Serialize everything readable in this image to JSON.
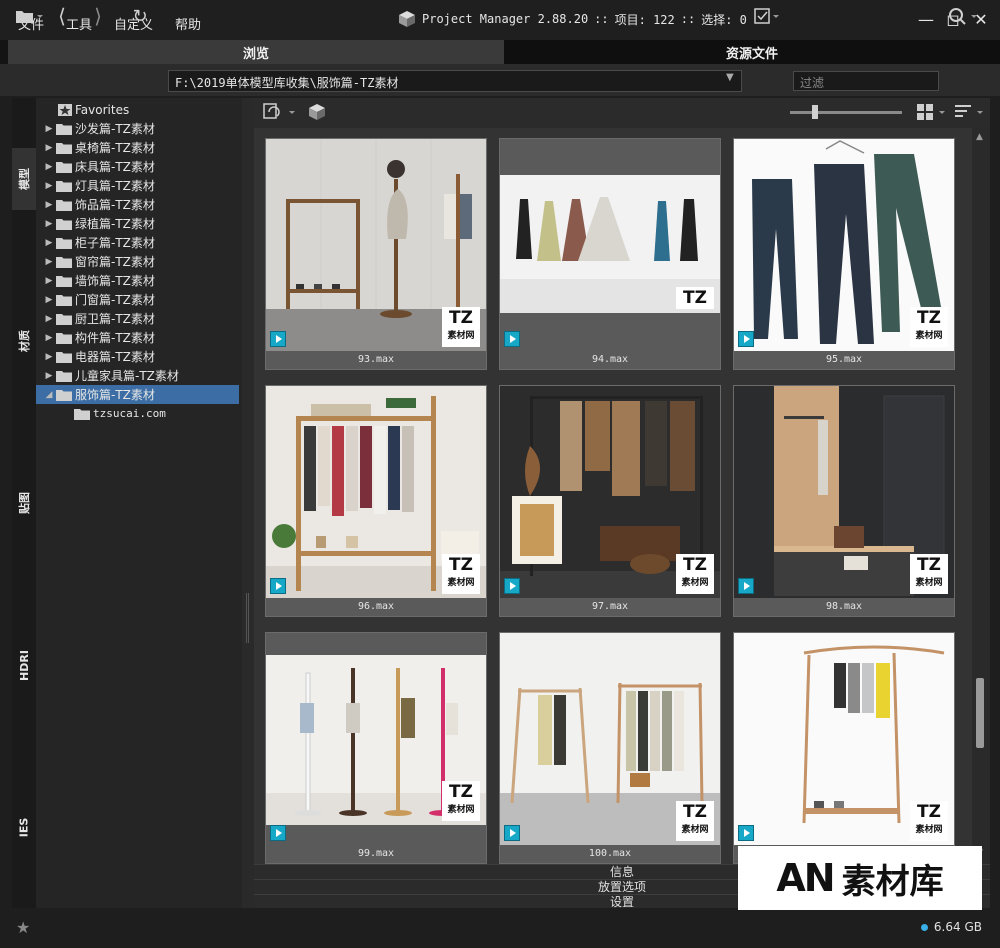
{
  "menu": [
    "文件",
    "工具",
    "自定义",
    "帮助"
  ],
  "app": {
    "title": "Project Manager 2.88.20",
    "items_label": "项目: 122",
    "selection_label": "选择: 0",
    "separator": "::"
  },
  "tabs": [
    {
      "label": "浏览",
      "active": true
    },
    {
      "label": "资源文件",
      "active": false
    }
  ],
  "toolbar": {
    "path": "F:\\2019单体模型库收集\\服饰篇-TZ素材",
    "filter_placeholder": "过滤"
  },
  "side_tabs": [
    "模型",
    "材质",
    "贴图",
    "HDRI",
    "IES"
  ],
  "tree": {
    "favorites_label": "Favorites",
    "items": [
      "沙发篇-TZ素材",
      "桌椅篇-TZ素材",
      "床具篇-TZ素材",
      "灯具篇-TZ素材",
      "饰品篇-TZ素材",
      "绿植篇-TZ素材",
      "柜子篇-TZ素材",
      "窗帘篇-TZ素材",
      "墙饰篇-TZ素材",
      "门窗篇-TZ素材",
      "厨卫篇-TZ素材",
      "构件篇-TZ素材",
      "电器篇-TZ素材",
      "儿童家具篇-TZ素材",
      "服饰篇-TZ素材"
    ],
    "selected_index": 14,
    "child_label": "tzsucai.com"
  },
  "cards": [
    {
      "label": "93.max",
      "tz": "TZ",
      "tz_sub": "素材网"
    },
    {
      "label": "94.max",
      "tz": "TZ",
      "tz_sub": ""
    },
    {
      "label": "95.max",
      "tz": "TZ",
      "tz_sub": "素材网"
    },
    {
      "label": "96.max",
      "tz": "TZ",
      "tz_sub": "素材网"
    },
    {
      "label": "97.max",
      "tz": "TZ",
      "tz_sub": "素材网"
    },
    {
      "label": "98.max",
      "tz": "TZ",
      "tz_sub": "素材网"
    },
    {
      "label": "99.max",
      "tz": "TZ",
      "tz_sub": "素材网"
    },
    {
      "label": "100.max",
      "tz": "TZ",
      "tz_sub": "素材网"
    },
    {
      "label": "",
      "tz": "TZ",
      "tz_sub": "素材网"
    }
  ],
  "bottom_panels": [
    "信息",
    "放置选项",
    "设置"
  ],
  "status": {
    "disk_free": "6.64 GB",
    "disk_color": "#3ab0e8"
  },
  "watermark": {
    "an": "AN",
    "cn": "素材库"
  },
  "colors": {
    "selection": "#3c6ea5",
    "max_badge": "#17a8c8"
  }
}
